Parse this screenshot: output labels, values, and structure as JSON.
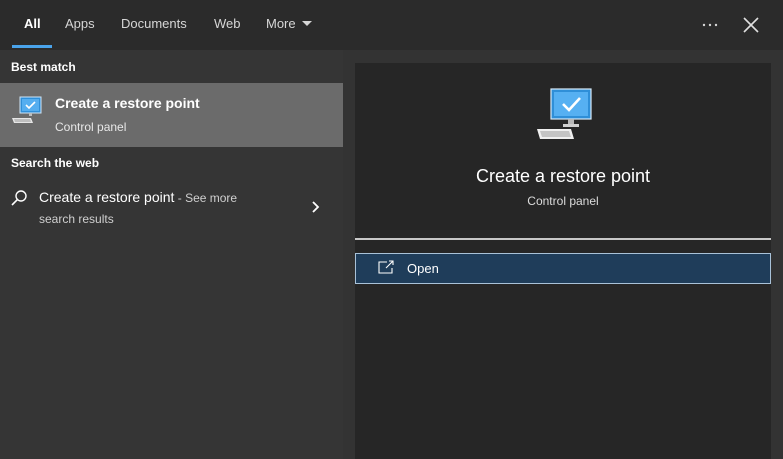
{
  "tabs": [
    {
      "label": "All",
      "active": true
    },
    {
      "label": "Apps",
      "active": false
    },
    {
      "label": "Documents",
      "active": false
    },
    {
      "label": "Web",
      "active": false
    },
    {
      "label": "More",
      "active": false
    }
  ],
  "top_icons": [
    "more-options-icon",
    "close-icon"
  ],
  "best_match": {
    "heading": "Best match",
    "title": "Create a restore point",
    "subtitle": "Control panel",
    "icon": "computer-restore-icon"
  },
  "search_web": {
    "heading": "Search the web",
    "query": "Create a restore point",
    "see_more": " - See more",
    "line2": "search results",
    "icon": "search-icon"
  },
  "detail": {
    "title": "Create a restore point",
    "subtitle": "Control panel",
    "icon": "computer-restore-icon",
    "action_label": "Open",
    "action_icon": "open-external-icon"
  },
  "colors": {
    "accent": "#4aa3ea",
    "selected_row": "#6b6b6b",
    "action_bg": "#1f3d5a"
  }
}
